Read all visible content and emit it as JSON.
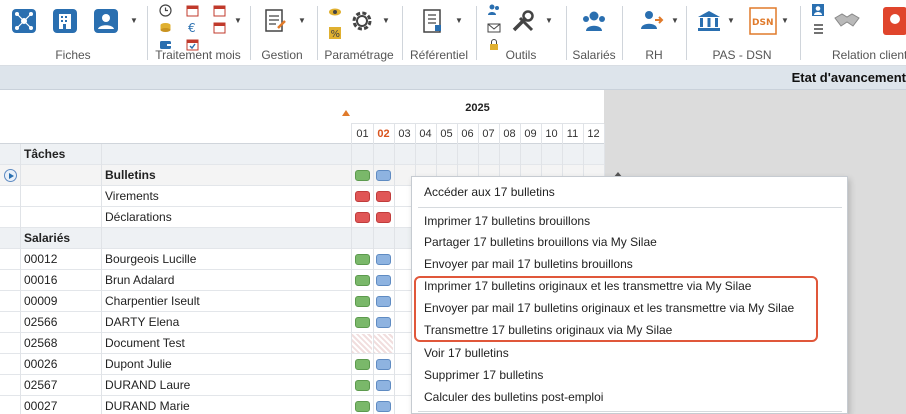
{
  "ribbon": {
    "groups": [
      {
        "label": "Fiches"
      },
      {
        "label": "Traitement mois"
      },
      {
        "label": "Gestion"
      },
      {
        "label": "Paramétrage"
      },
      {
        "label": "Référentiel"
      },
      {
        "label": "Outils"
      },
      {
        "label": "Salariés"
      },
      {
        "label": "RH"
      },
      {
        "label": "PAS - DSN"
      },
      {
        "label": "Relation client"
      }
    ],
    "icons": {
      "dsn_badge": "DSN"
    }
  },
  "titlebar": {
    "title": "Etat d'avancement"
  },
  "grid": {
    "year": "2025",
    "months": [
      "01",
      "02",
      "03",
      "04",
      "05",
      "06",
      "07",
      "08",
      "09",
      "10",
      "11",
      "12"
    ],
    "current_month": "02",
    "section_tasks": "Tâches",
    "tasks": [
      "Bulletins",
      "Virements",
      "Déclarations"
    ],
    "section_employees": "Salariés",
    "employees": [
      {
        "id": "00012",
        "name": "Bourgeois Lucille"
      },
      {
        "id": "00016",
        "name": "Brun Adalard"
      },
      {
        "id": "00009",
        "name": "Charpentier Iseult"
      },
      {
        "id": "02566",
        "name": "DARTY Elena"
      },
      {
        "id": "02568",
        "name": "Document Test"
      },
      {
        "id": "00026",
        "name": "Dupont Julie"
      },
      {
        "id": "02567",
        "name": "DURAND Laure"
      },
      {
        "id": "00027",
        "name": "DURAND Marie"
      }
    ]
  },
  "menu": {
    "items": [
      "Accéder aux 17 bulletins",
      "Imprimer 17 bulletins brouillons",
      "Partager 17 bulletins brouillons via My Silae",
      "Envoyer par mail 17 bulletins brouillons",
      "Imprimer 17 bulletins originaux et les transmettre via My Silae",
      "Envoyer par mail 17 bulletins originaux et les transmettre via My Silae",
      "Transmettre 17 bulletins originaux via My Silae",
      "Voir 17 bulletins",
      "Supprimer 17 bulletins",
      "Calculer des bulletins post-emploi"
    ]
  },
  "colors": {
    "ribbon_icon": "#2a6fb0",
    "accent_orange": "#e07a2a",
    "highlight": "#e0573a",
    "status_green": "#7ab86a",
    "status_red": "#e05656",
    "status_blue": "#8eb3e0"
  }
}
